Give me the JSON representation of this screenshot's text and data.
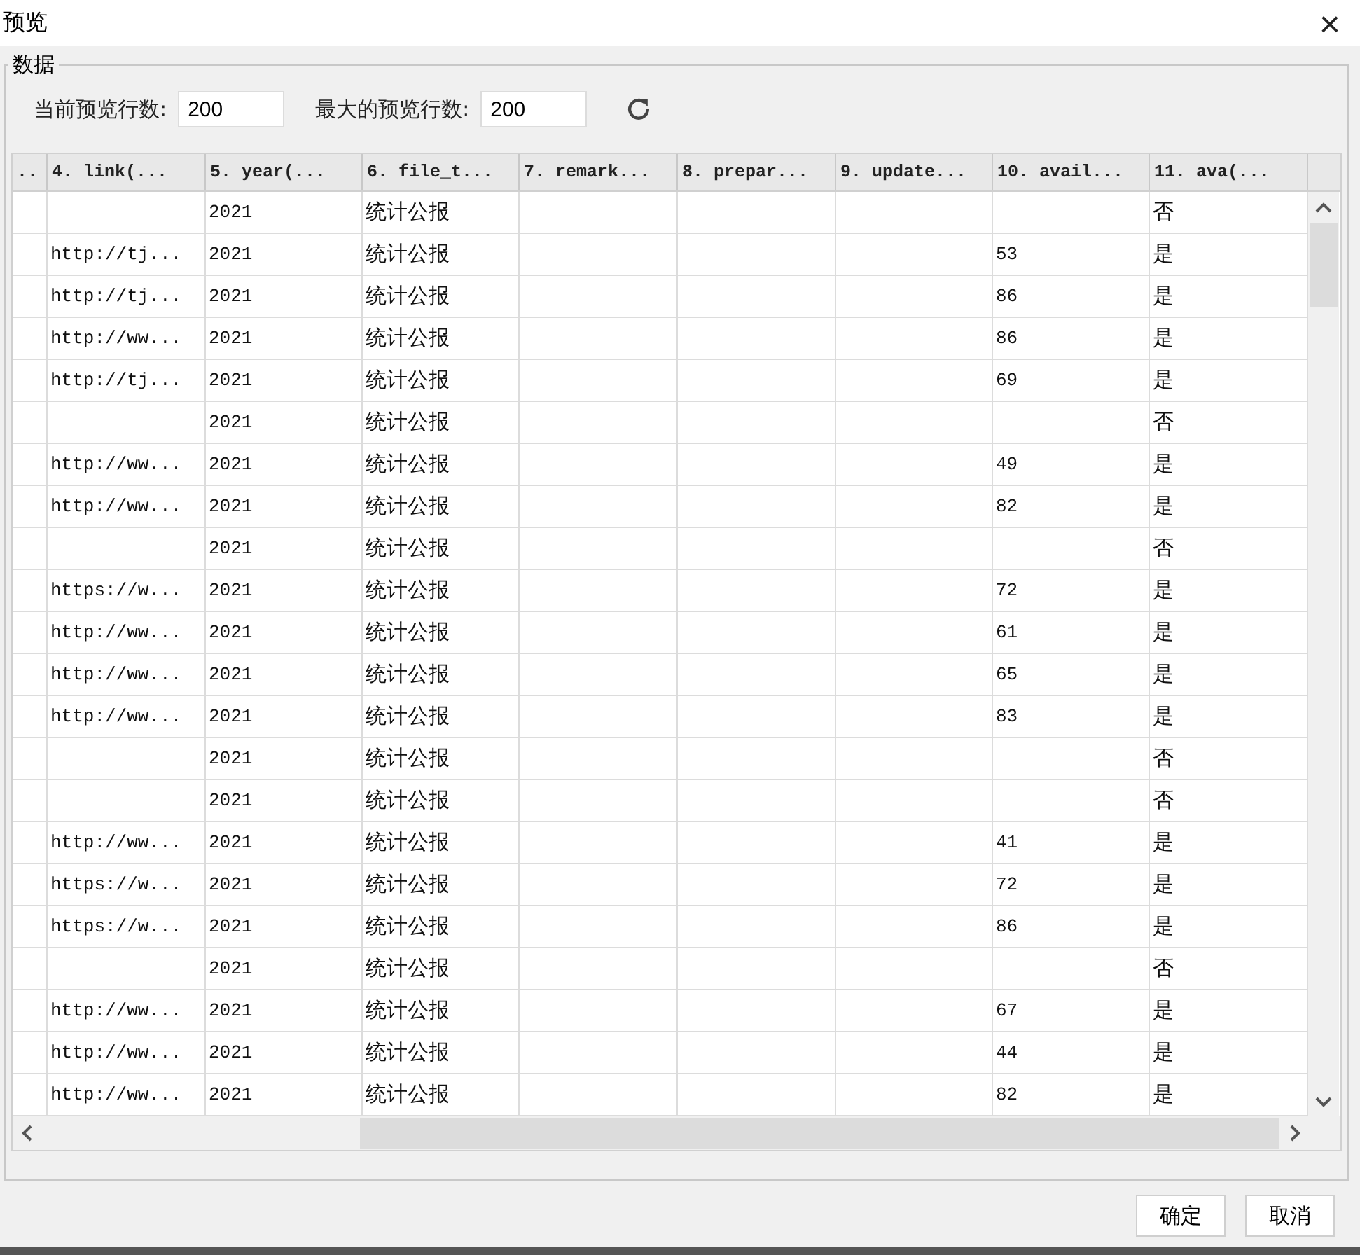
{
  "window": {
    "title": "预览",
    "close": "×"
  },
  "group": {
    "title": "数据"
  },
  "controls": [
    {
      "label": "当前预览行数:",
      "value": "200"
    },
    {
      "label": "最大的预览行数:",
      "value": "200"
    }
  ],
  "table": {
    "columns": [
      "..",
      "4. link(...",
      "5. year(...",
      "6. file_t...",
      "7. remark...",
      "8. prepar...",
      "9. update...",
      "10. avail...",
      "11. ava(..."
    ],
    "rows": [
      [
        null,
        null,
        "2021",
        "统计公报",
        null,
        null,
        null,
        null,
        "否"
      ],
      [
        null,
        "http://tj...",
        "2021",
        "统计公报",
        null,
        null,
        null,
        "53",
        "是"
      ],
      [
        null,
        "http://tj...",
        "2021",
        "统计公报",
        null,
        null,
        null,
        "86",
        "是"
      ],
      [
        null,
        "http://ww...",
        "2021",
        "统计公报",
        null,
        null,
        null,
        "86",
        "是"
      ],
      [
        null,
        "http://tj...",
        "2021",
        "统计公报",
        null,
        null,
        null,
        "69",
        "是"
      ],
      [
        null,
        null,
        "2021",
        "统计公报",
        null,
        null,
        null,
        null,
        "否"
      ],
      [
        null,
        "http://ww...",
        "2021",
        "统计公报",
        null,
        null,
        null,
        "49",
        "是"
      ],
      [
        null,
        "http://ww...",
        "2021",
        "统计公报",
        null,
        null,
        null,
        "82",
        "是"
      ],
      [
        null,
        null,
        "2021",
        "统计公报",
        null,
        null,
        null,
        null,
        "否"
      ],
      [
        null,
        "https://w...",
        "2021",
        "统计公报",
        null,
        null,
        null,
        "72",
        "是"
      ],
      [
        null,
        "http://ww...",
        "2021",
        "统计公报",
        null,
        null,
        null,
        "61",
        "是"
      ],
      [
        null,
        "http://ww...",
        "2021",
        "统计公报",
        null,
        null,
        null,
        "65",
        "是"
      ],
      [
        null,
        "http://ww...",
        "2021",
        "统计公报",
        null,
        null,
        null,
        "83",
        "是"
      ],
      [
        null,
        null,
        "2021",
        "统计公报",
        null,
        null,
        null,
        null,
        "否"
      ],
      [
        null,
        null,
        "2021",
        "统计公报",
        null,
        null,
        null,
        null,
        "否"
      ],
      [
        null,
        "http://ww...",
        "2021",
        "统计公报",
        null,
        null,
        null,
        "41",
        "是"
      ],
      [
        null,
        "https://w...",
        "2021",
        "统计公报",
        null,
        null,
        null,
        "72",
        "是"
      ],
      [
        null,
        "https://w...",
        "2021",
        "统计公报",
        null,
        null,
        null,
        "86",
        "是"
      ],
      [
        null,
        null,
        "2021",
        "统计公报",
        null,
        null,
        null,
        null,
        "否"
      ],
      [
        null,
        "http://ww...",
        "2021",
        "统计公报",
        null,
        null,
        null,
        "67",
        "是"
      ],
      [
        null,
        "http://ww...",
        "2021",
        "统计公报",
        null,
        null,
        null,
        "44",
        "是"
      ],
      [
        null,
        "http://ww...",
        "2021",
        "统计公报",
        null,
        null,
        null,
        "82",
        "是"
      ]
    ]
  },
  "buttons": [
    "确定",
    "取消"
  ]
}
